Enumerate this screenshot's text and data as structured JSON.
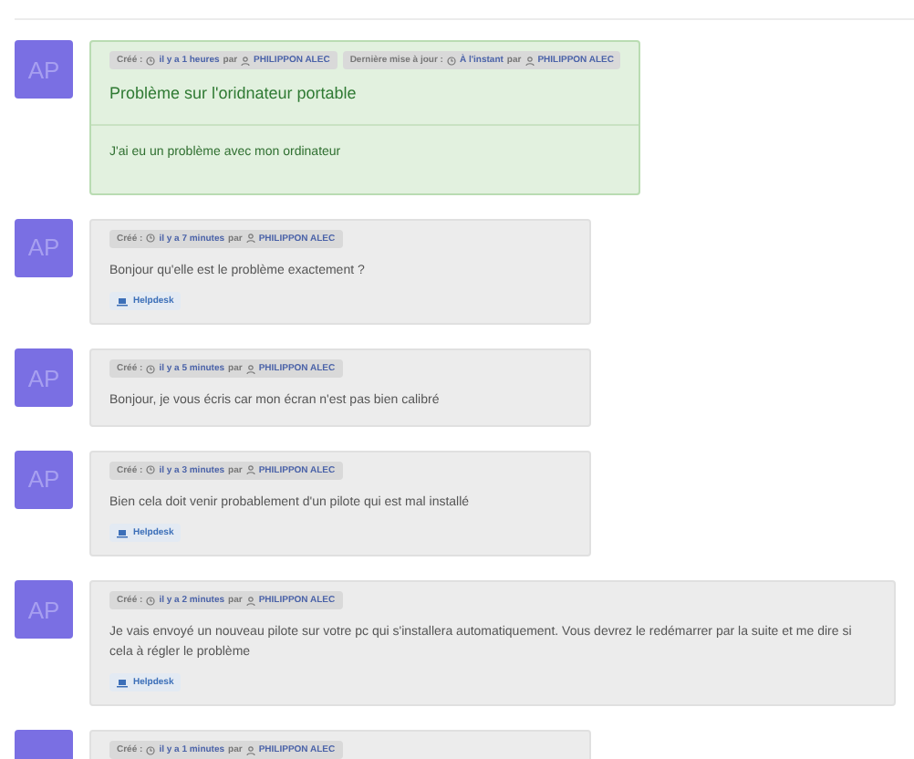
{
  "messages": [
    {
      "kind": "ticket",
      "avatar": "AP",
      "meta": [
        {
          "label": "Créé :",
          "time": "il y a 1 heures",
          "by": "par",
          "author": "PHILIPPON ALEC"
        },
        {
          "label": "Dernière mise à jour :",
          "time": "À l'instant",
          "by": "par",
          "author": "PHILIPPON ALEC"
        }
      ],
      "title": "Problème sur l'oridnateur portable",
      "body": "J'ai eu un problème avec mon ordinateur"
    },
    {
      "kind": "reply",
      "avatar": "AP",
      "meta": [
        {
          "label": "Créé :",
          "time": "il y a 7 minutes",
          "by": "par",
          "author": "PHILIPPON ALEC"
        }
      ],
      "body": "Bonjour qu'elle est le problème exactement ?",
      "tag": "Helpdesk"
    },
    {
      "kind": "reply",
      "avatar": "AP",
      "meta": [
        {
          "label": "Créé :",
          "time": "il y a 5 minutes",
          "by": "par",
          "author": "PHILIPPON ALEC"
        }
      ],
      "body": "Bonjour, je vous écris car mon écran n'est pas bien calibré"
    },
    {
      "kind": "reply",
      "avatar": "AP",
      "meta": [
        {
          "label": "Créé :",
          "time": "il y a 3 minutes",
          "by": "par",
          "author": "PHILIPPON ALEC"
        }
      ],
      "body": "Bien cela doit venir probablement d'un pilote qui est mal installé",
      "tag": "Helpdesk"
    },
    {
      "kind": "reply",
      "avatar": "AP",
      "meta": [
        {
          "label": "Créé :",
          "time": "il y a 2 minutes",
          "by": "par",
          "author": "PHILIPPON ALEC"
        }
      ],
      "body": "Je vais envoyé un nouveau pilote sur votre pc qui s'installera automatiquement. Vous devrez le redémarrer par la suite et me dire si cela à régler le problème",
      "tag": "Helpdesk"
    },
    {
      "kind": "reply",
      "meta": [
        {
          "label": "Créé :",
          "time": "il y a 1 minutes",
          "by": "par",
          "author": "PHILIPPON ALEC"
        }
      ]
    }
  ]
}
